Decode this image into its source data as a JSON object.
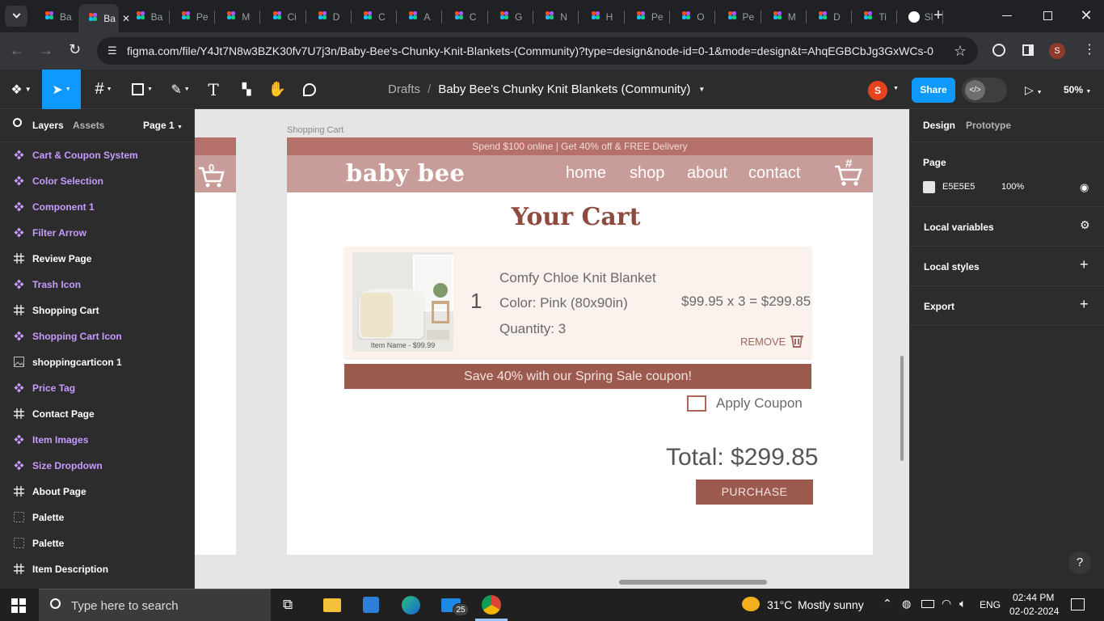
{
  "tabs": [
    {
      "label": "Ba",
      "active": false
    },
    {
      "label": "Ba",
      "active": true
    },
    {
      "label": "Ba",
      "active": false
    },
    {
      "label": "Pe",
      "active": false
    },
    {
      "label": "M",
      "active": false
    },
    {
      "label": "Ci",
      "active": false
    },
    {
      "label": "D",
      "active": false
    },
    {
      "label": "C",
      "active": false
    },
    {
      "label": "A",
      "active": false
    },
    {
      "label": "C",
      "active": false
    },
    {
      "label": "G",
      "active": false
    },
    {
      "label": "N",
      "active": false
    },
    {
      "label": "H",
      "active": false
    },
    {
      "label": "Pe",
      "active": false
    },
    {
      "label": "O",
      "active": false
    },
    {
      "label": "Pe",
      "active": false
    },
    {
      "label": "M",
      "active": false
    },
    {
      "label": "D",
      "active": false
    },
    {
      "label": "Ti",
      "active": false
    },
    {
      "label": "Sl",
      "active": false
    }
  ],
  "browser": {
    "url": "figma.com/file/Y4Jt7N8w3BZK30fv7U7j3n/Baby-Bee's-Chunky-Knit-Blankets-(Community)?type=design&node-id=0-1&mode=design&t=AhqEGBCbJg3GxWCs-0",
    "profile_initial": "S"
  },
  "figma": {
    "breadcrumb_root": "Drafts",
    "breadcrumb_sep": "/",
    "file_name": "Baby Bee's Chunky Knit Blankets (Community)",
    "user_initial": "S",
    "share_label": "Share",
    "zoom": "50%"
  },
  "left_panel": {
    "tabs": [
      "Layers",
      "Assets"
    ],
    "page": "Page 1",
    "layers": [
      {
        "name": "Cart & Coupon System",
        "kind": "component"
      },
      {
        "name": "Color Selection",
        "kind": "component"
      },
      {
        "name": "Component 1",
        "kind": "component"
      },
      {
        "name": "Filter Arrow",
        "kind": "component"
      },
      {
        "name": "Review Page",
        "kind": "frame"
      },
      {
        "name": "Trash Icon",
        "kind": "component"
      },
      {
        "name": "Shopping Cart",
        "kind": "frame"
      },
      {
        "name": "Shopping Cart Icon",
        "kind": "component"
      },
      {
        "name": "shoppingcarticon 1",
        "kind": "image"
      },
      {
        "name": "Price Tag",
        "kind": "component"
      },
      {
        "name": "Contact Page",
        "kind": "frame"
      },
      {
        "name": "Item Images",
        "kind": "component"
      },
      {
        "name": "Size Dropdown",
        "kind": "component"
      },
      {
        "name": "About Page",
        "kind": "frame"
      },
      {
        "name": "Palette",
        "kind": "section"
      },
      {
        "name": "Palette",
        "kind": "section"
      },
      {
        "name": "Item Description",
        "kind": "frame"
      }
    ]
  },
  "right_panel": {
    "tabs": [
      "Design",
      "Prototype"
    ],
    "page_label": "Page",
    "page_color": "E5E5E5",
    "page_opacity": "100%",
    "sections": [
      "Local variables",
      "Local styles",
      "Export"
    ],
    "help": "?"
  },
  "artboard": {
    "frame_label": "Shopping Cart",
    "promo": "Spend $100 online | Get 40% off & FREE Delivery",
    "brand": "baby bee",
    "nav": [
      "home",
      "shop",
      "about",
      "contact"
    ],
    "cart_badge": "#",
    "side_badge": "0",
    "heading": "Your Cart",
    "item": {
      "quantity_number": "1",
      "name": "Comfy Chloe Knit Blanket",
      "color": "Color: Pink (80x90in)",
      "quantity": "Quantity: 3",
      "price_calc": "$99.95 x 3 = $299.85",
      "remove": "REMOVE",
      "image_caption": "Item Name - $99.99"
    },
    "coupon_banner": "Save 40% with our Spring Sale coupon!",
    "apply_coupon": "Apply Coupon",
    "total": "Total: $299.85",
    "purchase": "PURCHASE"
  },
  "colors": {
    "promo_bar": "#b6706b",
    "header": "#c89c99",
    "heading": "#8e4a3f",
    "banner": "#9c5a4e",
    "card_bg": "#fbf1ed",
    "figma_blue": "#0d99ff",
    "component_purple": "#c79bff"
  },
  "taskbar": {
    "search_placeholder": "Type here to search",
    "mail_badge": "25",
    "weather_temp": "31°C",
    "weather_text": "Mostly sunny",
    "lang": "ENG",
    "time": "02:44 PM",
    "date": "02-02-2024"
  }
}
